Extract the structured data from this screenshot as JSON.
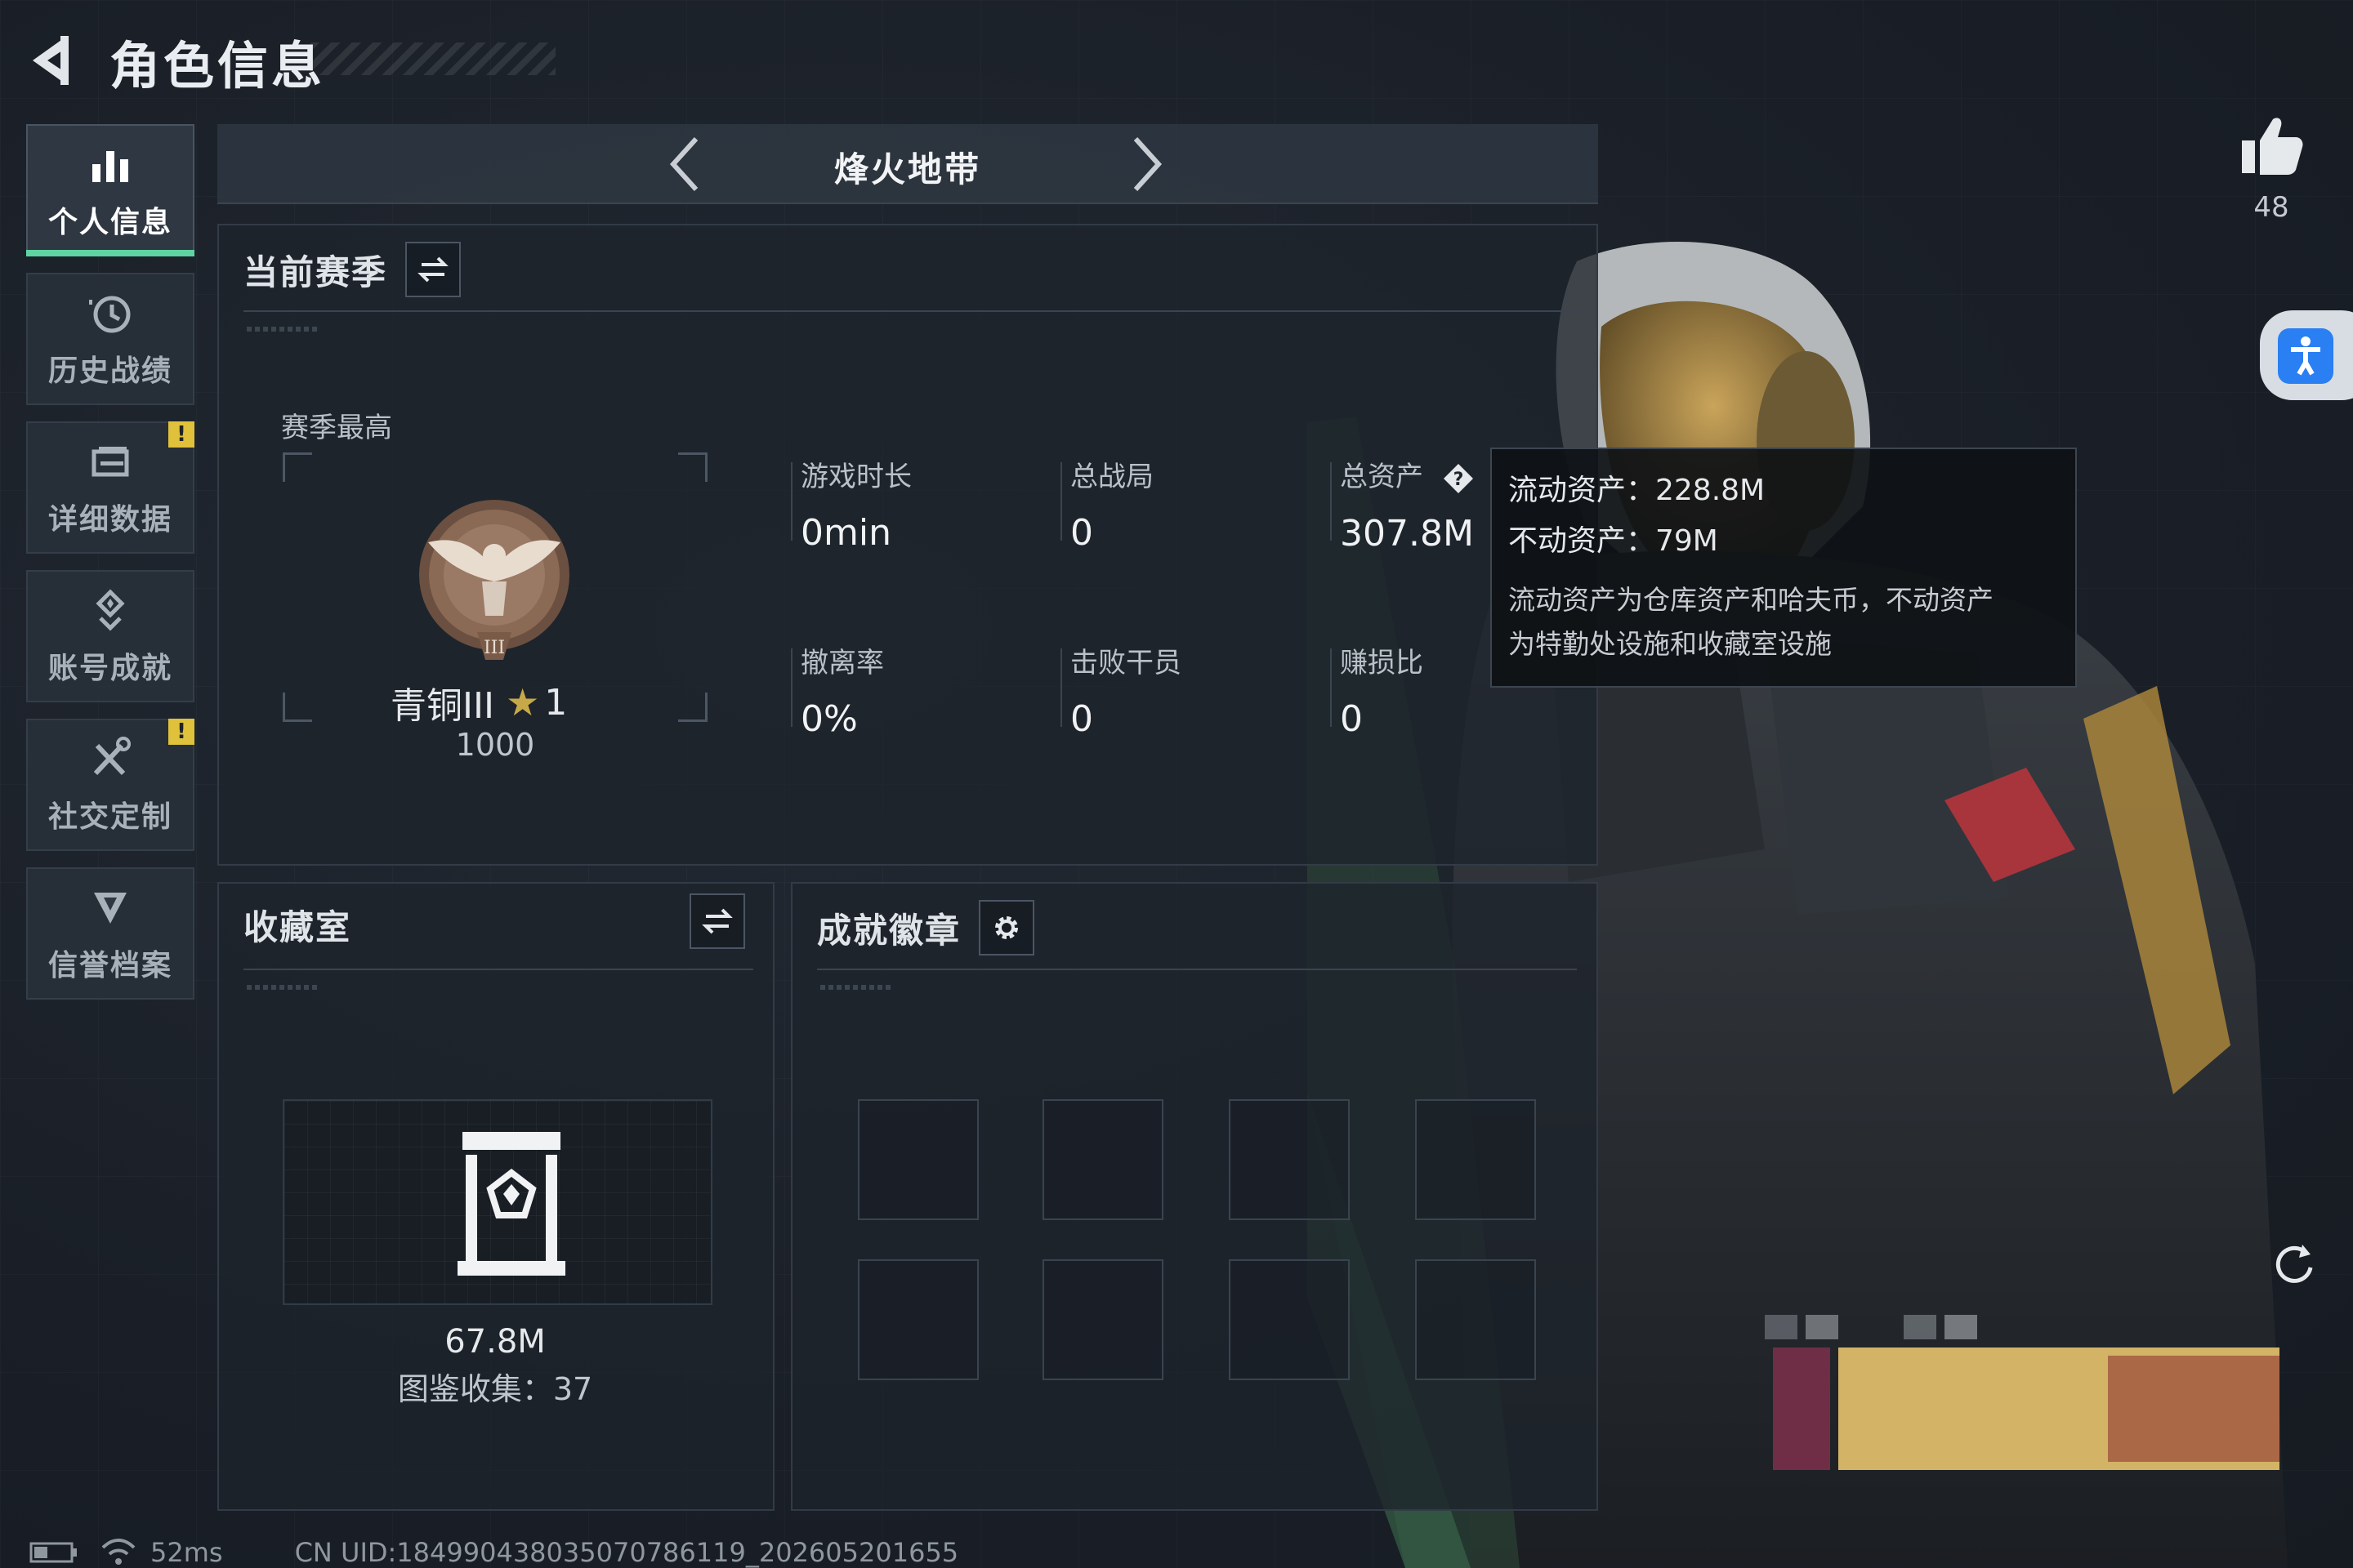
{
  "header": {
    "title": "角色信息"
  },
  "nav": {
    "items": [
      {
        "label": "个人信息",
        "icon": "bar-chart-icon",
        "active": true,
        "warning": false
      },
      {
        "label": "历史战绩",
        "icon": "history-clock-icon",
        "active": false,
        "warning": false
      },
      {
        "label": "详细数据",
        "icon": "folder-icon",
        "active": false,
        "warning": true
      },
      {
        "label": "账号成就",
        "icon": "achievement-icon",
        "active": false,
        "warning": false
      },
      {
        "label": "社交定制",
        "icon": "tools-icon",
        "active": false,
        "warning": true
      },
      {
        "label": "信誉档案",
        "icon": "shield-emblem-icon",
        "active": false,
        "warning": false
      }
    ],
    "warning_mark": "!"
  },
  "mode": {
    "title": "烽火地带"
  },
  "season": {
    "title": "当前赛季",
    "best_label": "赛季最高",
    "rank_name": "青铜III",
    "rank_stars": "1",
    "rank_score": "1000",
    "stats": {
      "play_time": {
        "label": "游戏时长",
        "value": "0min"
      },
      "total_matches": {
        "label": "总战局",
        "value": "0"
      },
      "total_assets": {
        "label": "总资产",
        "value": "307.8M"
      },
      "extract_rate": {
        "label": "撤离率",
        "value": "0%"
      },
      "kills": {
        "label": "击败干员",
        "value": "0"
      },
      "profit_ratio": {
        "label": "赚损比",
        "value": "0"
      }
    }
  },
  "tooltip": {
    "liquid": "流动资产：228.8M",
    "fixed": "不动资产：79M",
    "note_line1": "流动资产为仓库资产和哈夫币，不动资产",
    "note_line2": "为特勤处设施和收藏室设施"
  },
  "collection": {
    "title": "收藏室",
    "value": "67.8M",
    "count": "图鉴收集：37"
  },
  "badges": {
    "title": "成就徽章",
    "slot_count": 8
  },
  "likes": {
    "count": "48"
  },
  "status_bar": {
    "ping": "52ms",
    "uid": "CN UID:1849904380350707861​19_202605201655"
  },
  "colors": {
    "accent_green": "#5fd4a2",
    "warning_yellow": "#e0c13c",
    "rank_bronze": "#8a6a55",
    "access_blue": "#2a7ff3"
  }
}
